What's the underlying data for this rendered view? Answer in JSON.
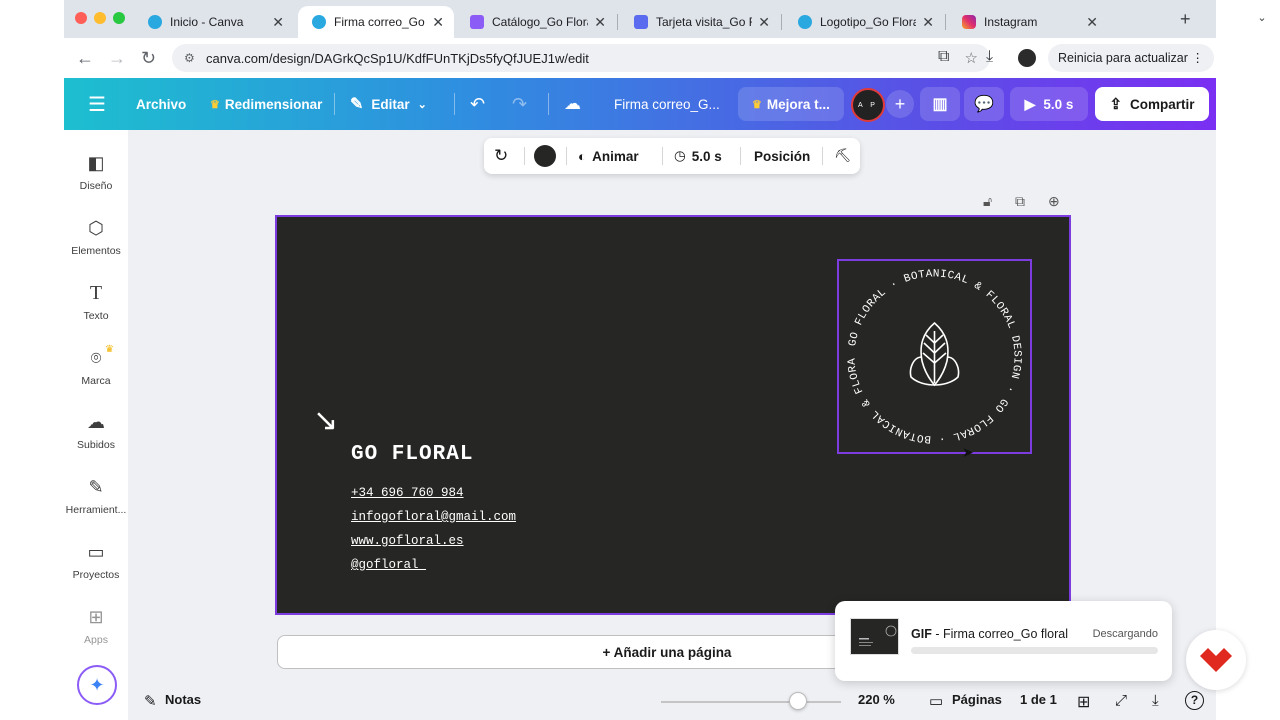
{
  "browser": {
    "tabs": [
      {
        "title": "Inicio - Canva",
        "active": false,
        "favicon_color": "#2aa8e0"
      },
      {
        "title": "Firma correo_Go floral",
        "active": true,
        "favicon_color": "#2aa8e0"
      },
      {
        "title": "Catálogo_Go Floral",
        "active": false,
        "favicon_color": "#8b5cf6"
      },
      {
        "title": "Tarjeta visita_Go Floral",
        "active": false,
        "favicon_color": "#5b6bf0"
      },
      {
        "title": "Logotipo_Go Floral",
        "active": false,
        "favicon_color": "#2aa8e0"
      },
      {
        "title": "Instagram",
        "active": false,
        "favicon_color": "#e1306c"
      }
    ],
    "url": "canva.com/design/DAGrkQcSp1U/KdfFUnTKjDs5fyQfJUEJ1w/edit",
    "update_label": "Reinicia para actualizar"
  },
  "toolbar": {
    "archivo": "Archivo",
    "redimensionar": "Redimensionar",
    "editar": "Editar",
    "doc_title": "Firma correo_G...",
    "upgrade": "Mejora t...",
    "avatar_initials": "A P",
    "duration": "5.0 s",
    "share": "Compartir"
  },
  "sidebar": {
    "items": [
      {
        "label": "Diseño",
        "icon": "layout-icon"
      },
      {
        "label": "Elementos",
        "icon": "elements-icon"
      },
      {
        "label": "Texto",
        "icon": "text-icon"
      },
      {
        "label": "Marca",
        "icon": "brand-icon"
      },
      {
        "label": "Subidos",
        "icon": "upload-icon"
      },
      {
        "label": "Herramient...",
        "icon": "draw-icon"
      },
      {
        "label": "Proyectos",
        "icon": "folder-icon"
      },
      {
        "label": "Apps",
        "icon": "apps-icon"
      }
    ]
  },
  "float_toolbar": {
    "animate": "Animar",
    "duration": "5.0 s",
    "position": "Posición"
  },
  "design": {
    "brand": "GO FLORAL",
    "phone": "+34 696 760 984",
    "email": "infogofloral@gmail.com",
    "web": "www.gofloral.es",
    "instagram": "@gofloral_",
    "logo_ring_text": "GO FLORAL · BOTANICAL & FLORAL DESIGN · GO FLORAL · BOTANICAL & FLORAL DESIGN ·"
  },
  "add_page": "+ Añadir una página",
  "download": {
    "format": "GIF",
    "name": " - Firma correo_Go floral",
    "status": "Descargando",
    "progress": 0.0
  },
  "bottom": {
    "notes": "Notas",
    "zoom": "220 %",
    "zoom_fraction": 0.76,
    "pages_label": "Páginas",
    "page_count": "1 de 1"
  },
  "colors": {
    "accent": "#7d3ce0",
    "canvas_bg": "#262624",
    "brand_red": "#e02a1f"
  }
}
